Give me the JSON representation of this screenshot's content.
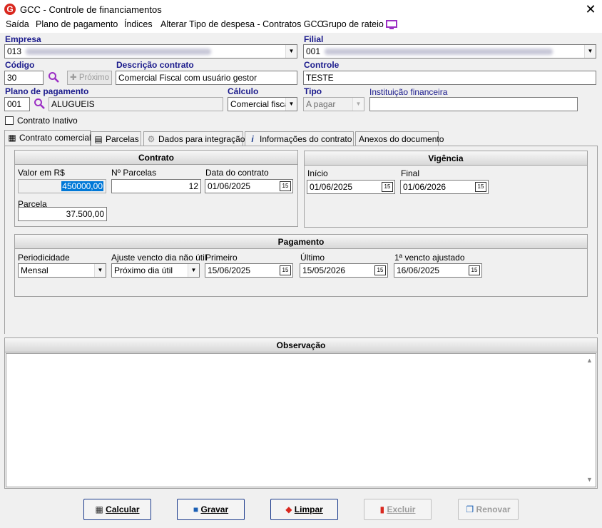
{
  "window": {
    "title": "GCC - Controle de financiamentos"
  },
  "menu": [
    "Saída",
    "Plano de pagamento",
    "Índices",
    "Alterar Tipo de despesa - Contratos GCC",
    "Grupo de rateio"
  ],
  "header": {
    "empresa": {
      "label": "Empresa",
      "code": "013"
    },
    "filial": {
      "label": "Filial",
      "code": "001"
    },
    "codigo": {
      "label": "Código",
      "value": "30"
    },
    "proximo_label": "Próximo",
    "descricao": {
      "label": "Descrição contrato",
      "value": "Comercial Fiscal com usuário gestor"
    },
    "controle": {
      "label": "Controle",
      "value": "TESTE"
    },
    "plano": {
      "label": "Plano de pagamento",
      "code": "001",
      "name": "ALUGUEIS"
    },
    "calculo": {
      "label": "Cálculo",
      "value": "Comercial fiscal"
    },
    "tipo": {
      "label": "Tipo",
      "value": "A pagar"
    },
    "instituicao": {
      "label": "Instituição financeira",
      "value": ""
    },
    "inativo_label": "Contrato Inativo"
  },
  "tabs": [
    {
      "label": "Contrato comercial",
      "icon": "calculator-icon"
    },
    {
      "label": "Parcelas",
      "icon": "document-icon"
    },
    {
      "label": "Dados para integração",
      "icon": "gear-icon"
    },
    {
      "label": "Informações do contrato",
      "icon": "info-icon"
    },
    {
      "label": "Anexos do documento",
      "icon": ""
    }
  ],
  "contrato": {
    "title": "Contrato",
    "valor_label": "Valor em R$",
    "valor": "450000,00",
    "nparcelas_label": "Nº Parcelas",
    "nparcelas": "12",
    "data_label": "Data do contrato",
    "data": "01/06/2025",
    "parcela_label": "Parcela",
    "parcela": "37.500,00"
  },
  "vigencia": {
    "title": "Vigência",
    "inicio_label": "Início",
    "inicio": "01/06/2025",
    "final_label": "Final",
    "final": "01/06/2026"
  },
  "pagamento": {
    "title": "Pagamento",
    "periodicidade_label": "Periodicidade",
    "periodicidade": "Mensal",
    "ajuste_label": "Ajuste vencto dia não útil",
    "ajuste": "Próximo dia útil",
    "primeiro_label": "Primeiro",
    "primeiro": "15/06/2025",
    "ultimo_label": "Último",
    "ultimo": "15/05/2026",
    "ajustado_label": "1ª vencto ajustado",
    "ajustado": "16/06/2025"
  },
  "observacao": {
    "title": "Observação",
    "value": ""
  },
  "footer": {
    "calcular": "Calcular",
    "gravar": "Gravar",
    "limpar": "Limpar",
    "excluir": "Excluir",
    "renovar": "Renovar"
  },
  "calendar_glyph": "15",
  "colors": {
    "label_blue": "#1a1a8c",
    "accent_red": "#d9281f",
    "menu_icon": "#9b2fc4"
  }
}
